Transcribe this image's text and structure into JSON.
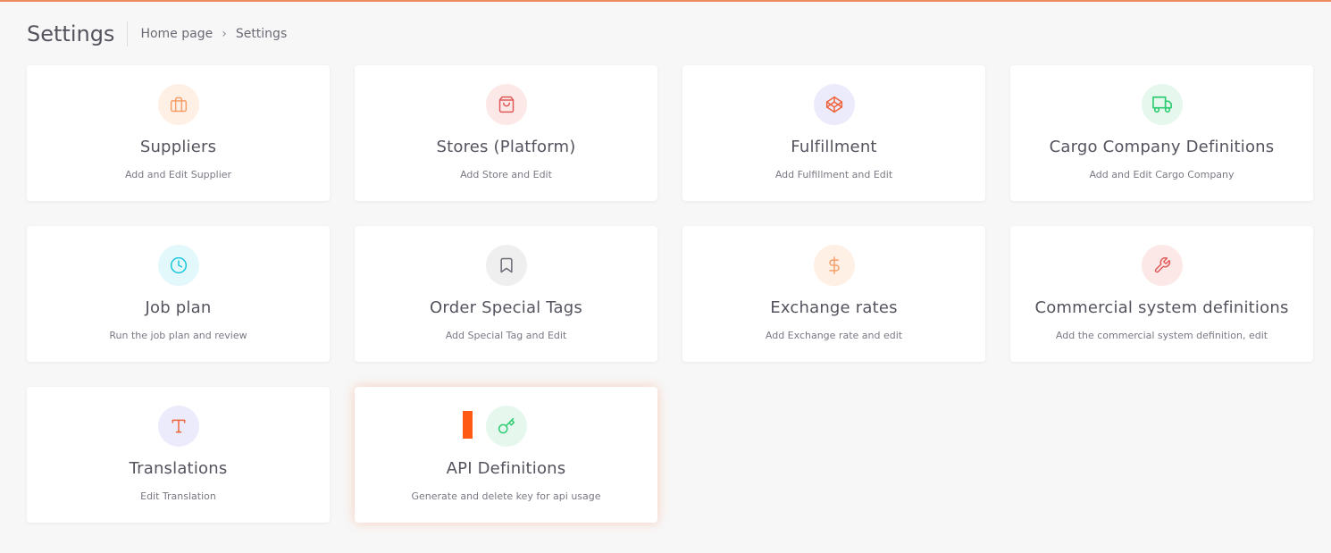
{
  "header": {
    "title": "Settings",
    "breadcrumb": [
      {
        "label": "Home page"
      },
      {
        "separator": "›"
      },
      {
        "label": "Settings"
      }
    ]
  },
  "cards": [
    {
      "title": "Suppliers",
      "subtitle": "Add and Edit Supplier",
      "icon": "briefcase-icon",
      "icon_color": "#f5a06a",
      "bg": "#fff0e6"
    },
    {
      "title": "Stores (Platform)",
      "subtitle": "Add Store and Edit",
      "icon": "shopping-bag-icon",
      "icon_color": "#e05a5a",
      "bg": "#fde8e8"
    },
    {
      "title": "Fulfillment",
      "subtitle": "Add Fulfillment and Edit",
      "icon": "codepen-icon",
      "icon_color": "#f0643c",
      "bg": "#ecebfb"
    },
    {
      "title": "Cargo Company Definitions",
      "subtitle": "Add and Edit Cargo Company",
      "icon": "truck-icon",
      "icon_color": "#2ecc71",
      "bg": "#e6f7ee"
    },
    {
      "title": "Job plan",
      "subtitle": "Run the job plan and review",
      "icon": "clock-icon",
      "icon_color": "#18c6dc",
      "bg": "#e2f8fb"
    },
    {
      "title": "Order Special Tags",
      "subtitle": "Add Special Tag and Edit",
      "icon": "bookmark-icon",
      "icon_color": "#6b6a75",
      "bg": "#efefef"
    },
    {
      "title": "Exchange rates",
      "subtitle": "Add Exchange rate and edit",
      "icon": "dollar-icon",
      "icon_color": "#f5a06a",
      "bg": "#fff0e6"
    },
    {
      "title": "Commercial system definitions",
      "subtitle": "Add the commercial system definition, edit",
      "icon": "wrench-icon",
      "icon_color": "#e05a5a",
      "bg": "#fde8e8"
    },
    {
      "title": "Translations",
      "subtitle": "Edit Translation",
      "icon": "type-icon",
      "icon_color": "#f0643c",
      "bg": "#ecebfb"
    },
    {
      "title": "API Definitions",
      "subtitle": "Generate and delete key for api usage",
      "icon": "key-icon",
      "icon_color": "#2ecc71",
      "bg": "#e6f7ee",
      "active": true,
      "active_marker_color": "#ff5a14"
    }
  ]
}
